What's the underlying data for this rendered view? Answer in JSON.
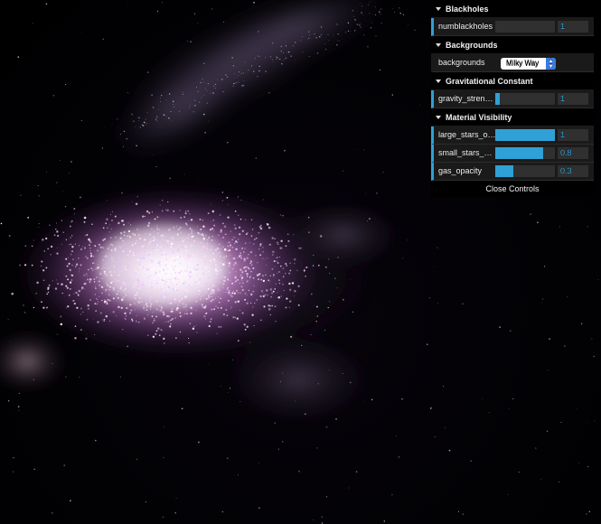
{
  "gui": {
    "folders": [
      {
        "title": "Blackholes",
        "controls": [
          {
            "label": "numblackholes",
            "type": "number",
            "value": "1",
            "fill": 0
          }
        ]
      },
      {
        "title": "Backgrounds",
        "controls": [
          {
            "label": "backgrounds",
            "type": "select",
            "value": "Milky Way"
          }
        ]
      },
      {
        "title": "Gravitational Constant",
        "controls": [
          {
            "label": "gravity_strength",
            "type": "number",
            "value": "1",
            "fill": 0.08
          }
        ]
      },
      {
        "title": "Material Visibility",
        "controls": [
          {
            "label": "large_stars_op...",
            "type": "number",
            "value": "1",
            "fill": 1.0
          },
          {
            "label": "small_stars_op...",
            "type": "number",
            "value": "0.8",
            "fill": 0.8
          },
          {
            "label": "gas_opacity",
            "type": "number",
            "value": "0.3",
            "fill": 0.3
          }
        ]
      }
    ],
    "close_label": "Close Controls"
  },
  "colors": {
    "accent": "#2fa1d6",
    "panel_bg": "#1a1a1a",
    "select_arrow": "#3b7be0"
  },
  "icons": {
    "folder_toggle": "caret-down-icon",
    "select_arrow": "up-down-arrows-icon"
  }
}
